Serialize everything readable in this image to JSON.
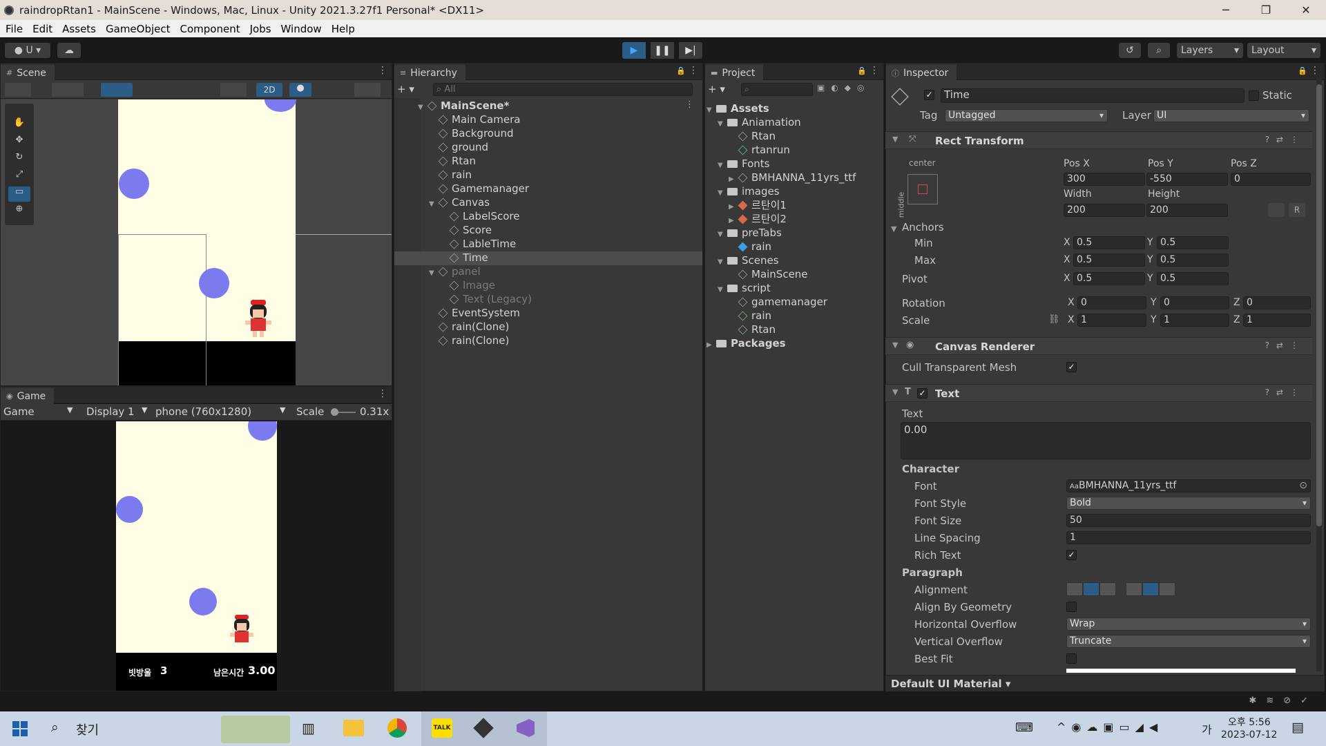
{
  "window": {
    "title": "raindropRtan1 - MainScene - Windows, Mac, Linux - Unity 2021.3.27f1 Personal* <DX11>",
    "min": "─",
    "max": "❐",
    "close": "✕"
  },
  "menu": [
    "File",
    "Edit",
    "Assets",
    "GameObject",
    "Component",
    "Jobs",
    "Window",
    "Help"
  ],
  "toolbar": {
    "account": "U",
    "layers": "Layers",
    "layout": "Layout"
  },
  "scene": {
    "tab": "Scene",
    "mode_2d": "2D"
  },
  "game": {
    "tab": "Game",
    "mode": "Game",
    "display": "Display 1",
    "resolution": "phone (760x1280)",
    "scale_label": "Scale",
    "scale_value": "0.31x",
    "score_label": "빗방울",
    "score_value": "3",
    "time_label": "남은시간",
    "time_value": "3.00"
  },
  "hierarchy": {
    "tab": "Hierarchy",
    "search": "All",
    "items": [
      {
        "label": "MainScene*",
        "depth": 0,
        "expand": "▼",
        "kind": "scene",
        "style": "bold"
      },
      {
        "label": "Main Camera",
        "depth": 1,
        "expand": "",
        "kind": "obj",
        "style": ""
      },
      {
        "label": "Background",
        "depth": 1,
        "expand": "",
        "kind": "obj",
        "style": ""
      },
      {
        "label": "ground",
        "depth": 1,
        "expand": "",
        "kind": "obj",
        "style": ""
      },
      {
        "label": "Rtan",
        "depth": 1,
        "expand": "",
        "kind": "obj",
        "style": ""
      },
      {
        "label": "rain",
        "depth": 1,
        "expand": "",
        "kind": "obj",
        "style": ""
      },
      {
        "label": "Gamemanager",
        "depth": 1,
        "expand": "",
        "kind": "obj",
        "style": ""
      },
      {
        "label": "Canvas",
        "depth": 1,
        "expand": "▼",
        "kind": "obj",
        "style": ""
      },
      {
        "label": "LabelScore",
        "depth": 2,
        "expand": "",
        "kind": "obj",
        "style": ""
      },
      {
        "label": "Score",
        "depth": 2,
        "expand": "",
        "kind": "obj",
        "style": ""
      },
      {
        "label": "LableTime",
        "depth": 2,
        "expand": "",
        "kind": "obj",
        "style": ""
      },
      {
        "label": "Time",
        "depth": 2,
        "expand": "",
        "kind": "obj",
        "style": "selected"
      },
      {
        "label": "panel",
        "depth": 1,
        "expand": "▼",
        "kind": "obj",
        "style": "dim"
      },
      {
        "label": "Image",
        "depth": 2,
        "expand": "",
        "kind": "obj",
        "style": "dim"
      },
      {
        "label": "Text (Legacy)",
        "depth": 2,
        "expand": "",
        "kind": "obj",
        "style": "dim"
      },
      {
        "label": "EventSystem",
        "depth": 1,
        "expand": "",
        "kind": "obj",
        "style": ""
      },
      {
        "label": "rain(Clone)",
        "depth": 1,
        "expand": "",
        "kind": "obj",
        "style": ""
      },
      {
        "label": "rain(Clone)",
        "depth": 1,
        "expand": "",
        "kind": "obj",
        "style": ""
      }
    ]
  },
  "project": {
    "tab": "Project",
    "items": [
      {
        "label": "Assets",
        "depth": 0,
        "expand": "▼",
        "kind": "folder",
        "style": "bold"
      },
      {
        "label": "Aniamation",
        "depth": 1,
        "expand": "▼",
        "kind": "folder",
        "style": ""
      },
      {
        "label": "Rtan",
        "depth": 2,
        "expand": "",
        "kind": "anim",
        "style": ""
      },
      {
        "label": "rtanrun",
        "depth": 2,
        "expand": "",
        "kind": "clip",
        "style": ""
      },
      {
        "label": "Fonts",
        "depth": 1,
        "expand": "▼",
        "kind": "folder",
        "style": ""
      },
      {
        "label": "BMHANNA_11yrs_ttf",
        "depth": 2,
        "expand": "▶",
        "kind": "font",
        "style": ""
      },
      {
        "label": "images",
        "depth": 1,
        "expand": "▼",
        "kind": "folder",
        "style": ""
      },
      {
        "label": "르탄이1",
        "depth": 2,
        "expand": "▶",
        "kind": "sprite",
        "style": ""
      },
      {
        "label": "르탄이2",
        "depth": 2,
        "expand": "▶",
        "kind": "sprite",
        "style": ""
      },
      {
        "label": "preTabs",
        "depth": 1,
        "expand": "▼",
        "kind": "folder",
        "style": ""
      },
      {
        "label": "rain",
        "depth": 2,
        "expand": "",
        "kind": "prefab",
        "style": ""
      },
      {
        "label": "Scenes",
        "depth": 1,
        "expand": "▼",
        "kind": "folder",
        "style": ""
      },
      {
        "label": "MainScene",
        "depth": 2,
        "expand": "",
        "kind": "scene",
        "style": ""
      },
      {
        "label": "script",
        "depth": 1,
        "expand": "▼",
        "kind": "folder",
        "style": ""
      },
      {
        "label": "gamemanager",
        "depth": 2,
        "expand": "",
        "kind": "gear",
        "style": ""
      },
      {
        "label": "rain",
        "depth": 2,
        "expand": "",
        "kind": "cs",
        "style": ""
      },
      {
        "label": "Rtan",
        "depth": 2,
        "expand": "",
        "kind": "cs",
        "style": ""
      },
      {
        "label": "Packages",
        "depth": 0,
        "expand": "▶",
        "kind": "folder",
        "style": "bold"
      }
    ]
  },
  "inspector": {
    "tab": "Inspector",
    "name": "Time",
    "static": "Static",
    "tag_label": "Tag",
    "tag": "Untagged",
    "layer_label": "Layer",
    "layer": "UI",
    "rect": {
      "title": "Rect Transform",
      "anchor_h": "center",
      "anchor_v": "middle",
      "posx_label": "Pos X",
      "posy_label": "Pos Y",
      "posz_label": "Pos Z",
      "posx": "300",
      "posy": "-550",
      "posz": "0",
      "width_label": "Width",
      "height_label": "Height",
      "width": "200",
      "height": "200",
      "r_btn": "R",
      "anchors": "Anchors",
      "min": "Min",
      "max": "Max",
      "pivot": "Pivot",
      "min_x": "0.5",
      "min_y": "0.5",
      "max_x": "0.5",
      "max_y": "0.5",
      "pivot_x": "0.5",
      "pivot_y": "0.5",
      "rotation": "Rotation",
      "rot_x": "0",
      "rot_y": "0",
      "rot_z": "0",
      "scale": "Scale",
      "scale_x": "1",
      "scale_y": "1",
      "scale_z": "1",
      "x": "X",
      "y": "Y",
      "z": "Z"
    },
    "canvas_renderer": {
      "title": "Canvas Renderer",
      "cull": "Cull Transparent Mesh"
    },
    "text": {
      "title": "Text",
      "text_label": "Text",
      "text_value": "0.00",
      "character": "Character",
      "font_label": "Font",
      "font": "BMHANNA_11yrs_ttf",
      "style_label": "Font Style",
      "style": "Bold",
      "size_label": "Font Size",
      "size": "50",
      "spacing_label": "Line Spacing",
      "spacing": "1",
      "rich_label": "Rich Text",
      "paragraph": "Paragraph",
      "align_label": "Alignment",
      "geom_label": "Align By Geometry",
      "hover_label": "Horizontal Overflow",
      "hover": "Wrap",
      "vover_label": "Vertical Overflow",
      "vover": "Truncate",
      "best_label": "Best Fit"
    },
    "material": "Default UI Material"
  },
  "taskbar": {
    "search": "찾기",
    "time": "오후 5:56",
    "date": "2023-07-12",
    "ime": "가"
  },
  "colors": {
    "accent_blue": "#2c5d87",
    "raindrop": "#7b7bef",
    "bg_cream": "#fefee6",
    "play_blue": "#4aa3ff"
  }
}
